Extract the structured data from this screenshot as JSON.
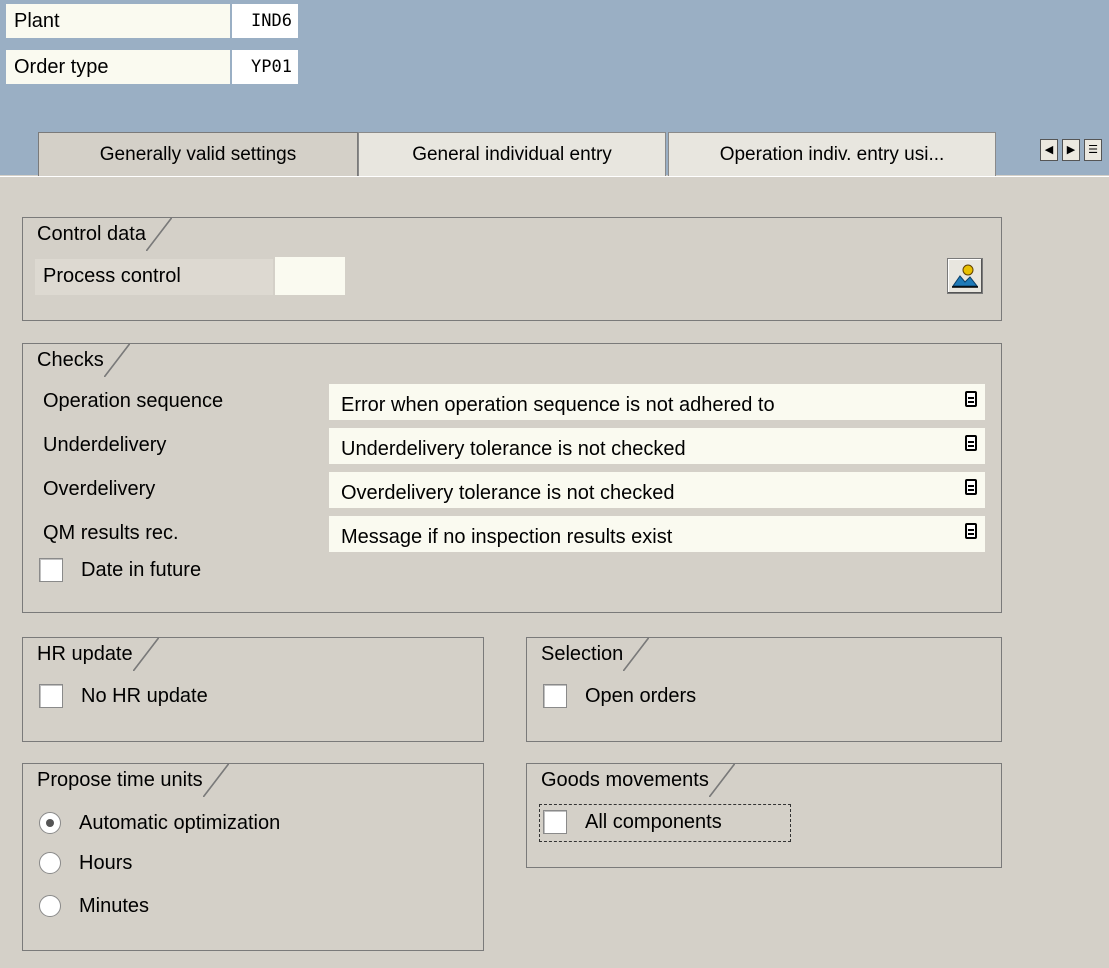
{
  "header": {
    "plant_label": "Plant",
    "plant_value": "IND6",
    "order_type_label": "Order type",
    "order_type_value": "YP01"
  },
  "tabs": [
    {
      "label": "Generally valid settings",
      "active": true
    },
    {
      "label": "General individual entry",
      "active": false
    },
    {
      "label": "Operation indiv. entry usi...",
      "active": false
    }
  ],
  "tab_nav": {
    "left_icon": "arrow-left-icon",
    "right_icon": "arrow-right-icon",
    "list_icon": "tab-list-icon"
  },
  "control_data": {
    "title": "Control data",
    "process_control_label": "Process control",
    "process_control_value": "",
    "button_icon": "person-landscape-icon"
  },
  "checks": {
    "title": "Checks",
    "rows": [
      {
        "label": "Operation sequence",
        "value": "Error when operation sequence is not adhered to"
      },
      {
        "label": "Underdelivery",
        "value": "Underdelivery tolerance is not checked"
      },
      {
        "label": "Overdelivery",
        "value": "Overdelivery tolerance is not checked"
      },
      {
        "label": "QM results rec.",
        "value": "Message if no inspection results exist"
      }
    ],
    "date_in_future_label": "Date in future",
    "date_in_future_checked": false
  },
  "hr_update": {
    "title": "HR update",
    "no_hr_update_label": "No HR update",
    "no_hr_update_checked": false
  },
  "selection": {
    "title": "Selection",
    "open_orders_label": "Open orders",
    "open_orders_checked": false
  },
  "propose_time_units": {
    "title": "Propose time units",
    "options": [
      {
        "label": "Automatic optimization",
        "selected": true
      },
      {
        "label": "Hours",
        "selected": false
      },
      {
        "label": "Minutes",
        "selected": false
      }
    ]
  },
  "goods_movements": {
    "title": "Goods movements",
    "all_components_label": "All components",
    "all_components_checked": false
  }
}
